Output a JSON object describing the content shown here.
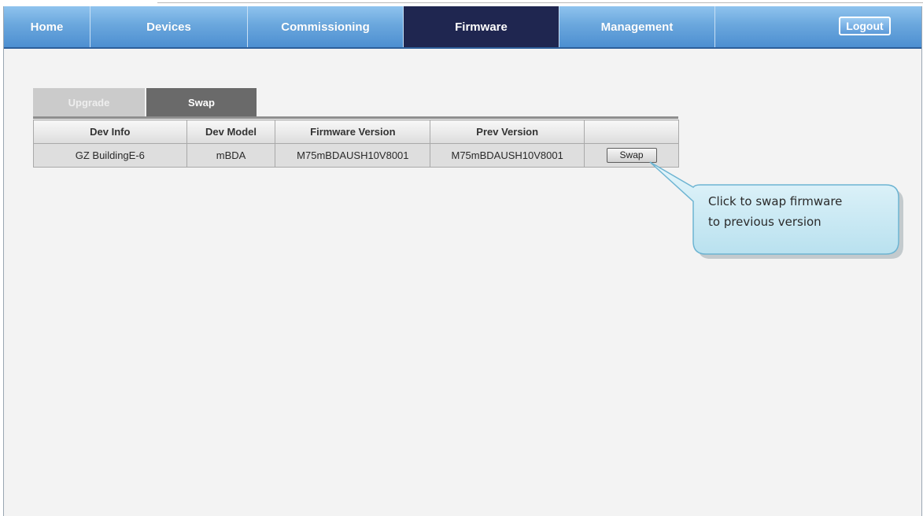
{
  "nav": {
    "items": [
      {
        "label": "Home"
      },
      {
        "label": "Devices"
      },
      {
        "label": "Commissioning"
      },
      {
        "label": "Firmware"
      },
      {
        "label": "Management"
      }
    ],
    "active": "Firmware",
    "logout_label": "Logout"
  },
  "tabs": [
    {
      "label": "Upgrade",
      "active": false
    },
    {
      "label": "Swap",
      "active": true
    }
  ],
  "table": {
    "headers": [
      "Dev Info",
      "Dev Model",
      "Firmware Version",
      "Prev Version",
      ""
    ],
    "rows": [
      {
        "dev_info": "GZ BuildingE-6",
        "dev_model": "mBDA",
        "firmware_version": "M75mBDAUSH10V8001",
        "prev_version": "M75mBDAUSH10V8001",
        "action_label": "Swap"
      }
    ]
  },
  "callout": {
    "line1": "Click to swap firmware",
    "line2": "to previous version"
  },
  "colors": {
    "nav_gradient_top": "#8fc3ee",
    "nav_gradient_bottom": "#4d8fd1",
    "nav_active": "#1f2650",
    "tab_active": "#6a6a6a",
    "tab_inactive": "#cbcbcb",
    "callout_fill": "#c9e9f4",
    "callout_border": "#6db4d2"
  }
}
